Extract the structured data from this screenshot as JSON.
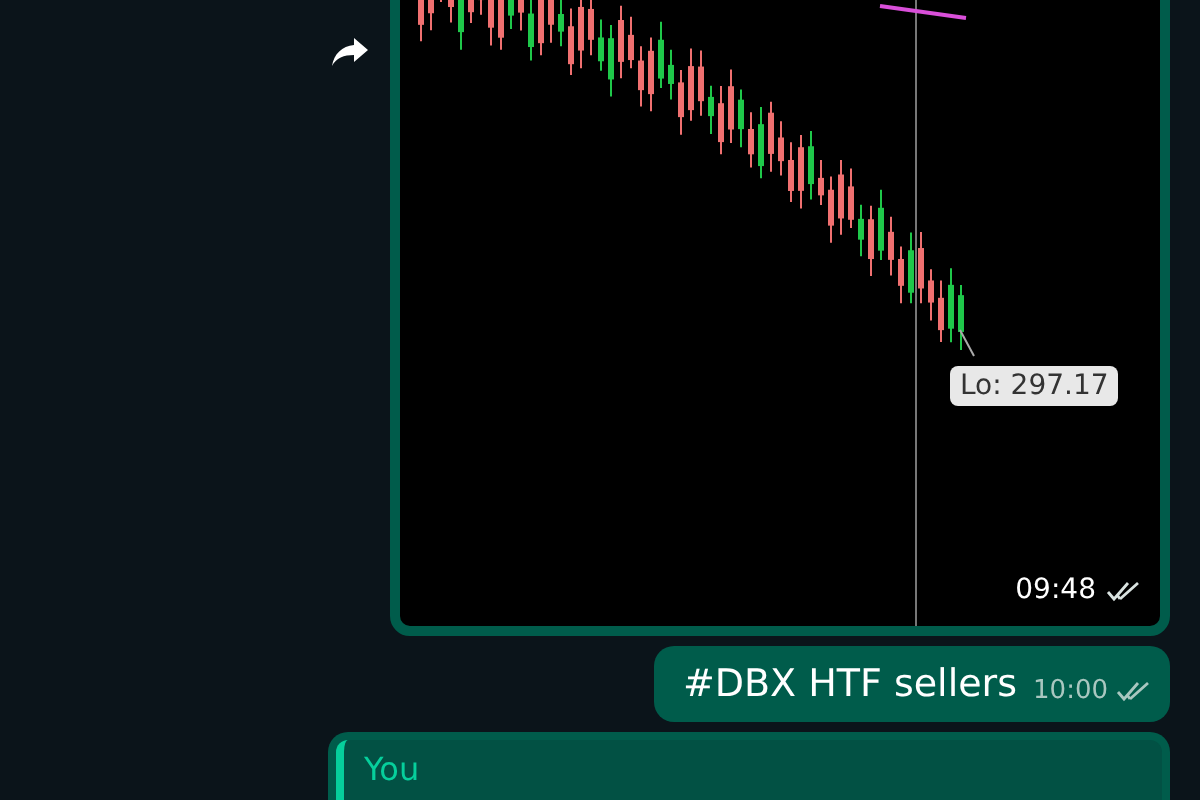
{
  "messages": [
    {
      "kind": "image",
      "tooltip": "Lo: 297.17",
      "time": "09:48",
      "read": false
    },
    {
      "kind": "text",
      "text": "#DBX HTF sellers",
      "time": "10:00",
      "read": false
    },
    {
      "kind": "reply",
      "quoted_author": "You"
    }
  ]
}
